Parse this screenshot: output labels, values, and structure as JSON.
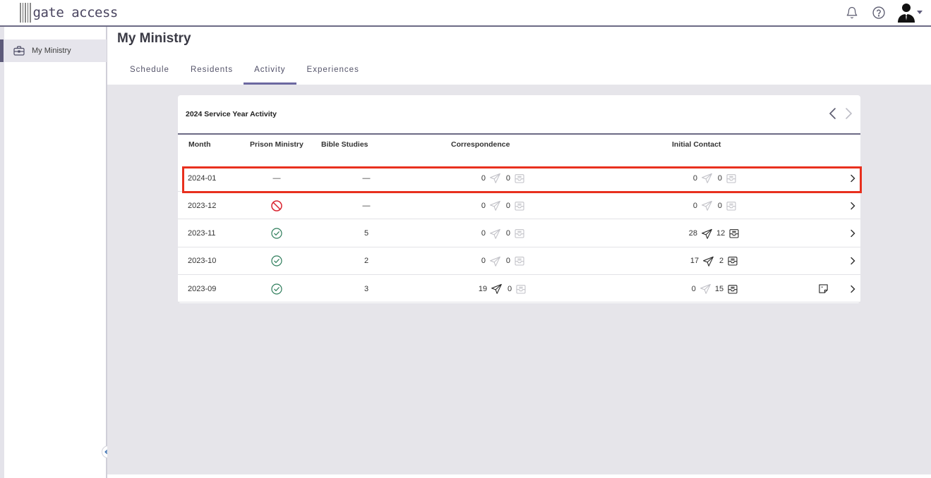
{
  "app": {
    "logo_text": "gate access"
  },
  "sidebar": {
    "items": [
      {
        "label": "My Ministry",
        "icon": "briefcase-icon"
      }
    ]
  },
  "header": {
    "title": "My Ministry",
    "tabs": [
      {
        "label": "Schedule",
        "active": false
      },
      {
        "label": "Residents",
        "active": false
      },
      {
        "label": "Activity",
        "active": true
      },
      {
        "label": "Experiences",
        "active": false
      }
    ]
  },
  "card": {
    "title": "2024 Service Year Activity",
    "columns": [
      "Month",
      "Prison Ministry",
      "Bible Studies",
      "Correspondence",
      "Initial Contact"
    ],
    "rows": [
      {
        "month": "2024-01",
        "prison_ministry": "—",
        "bible_studies": "—",
        "corr_sent": "0",
        "corr_recv": "0",
        "init_sent": "0",
        "init_recv": "0",
        "highlighted": true
      },
      {
        "month": "2023-12",
        "prison_ministry": "no-icon",
        "bible_studies": "—",
        "corr_sent": "0",
        "corr_recv": "0",
        "init_sent": "0",
        "init_recv": "0"
      },
      {
        "month": "2023-11",
        "prison_ministry": "check-icon",
        "bible_studies": "5",
        "corr_sent": "0",
        "corr_recv": "0",
        "init_sent": "28",
        "init_recv": "12"
      },
      {
        "month": "2023-10",
        "prison_ministry": "check-icon",
        "bible_studies": "2",
        "corr_sent": "0",
        "corr_recv": "0",
        "init_sent": "17",
        "init_recv": "2"
      },
      {
        "month": "2023-09",
        "prison_ministry": "check-icon",
        "bible_studies": "3",
        "corr_sent": "19",
        "corr_recv": "0",
        "init_sent": "0",
        "init_recv": "15",
        "has_note": true
      }
    ]
  },
  "colors": {
    "accent": "#6b68a0",
    "highlight": "#e8301e",
    "check": "#2e7d5b",
    "prohibit": "#d9232f"
  }
}
